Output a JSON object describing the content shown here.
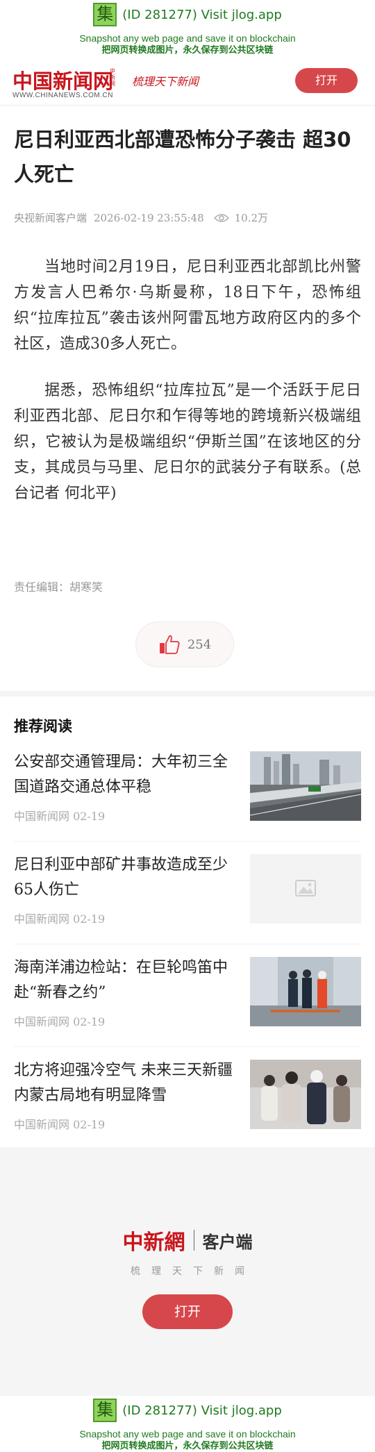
{
  "jlog": {
    "badge": "集",
    "title": "(ID 281277) Visit jlog.app",
    "sub_en": "Snapshot any web page and save it on blockchain",
    "sub_cn": "把网页转换成图片，永久保存到公共区块链"
  },
  "header": {
    "logo_cn": "中国新闻网",
    "logo_tag": "中新网",
    "logo_en": "WWW.CHINANEWS.COM.CN",
    "slogan": "梳理天下新闻",
    "open_label": "打开"
  },
  "article": {
    "headline": "尼日利亚西北部遭恐怖分子袭击 超30人死亡",
    "source": "央视新闻客户端",
    "datetime": "2026-02-19 23:55:48",
    "views": "10.2万",
    "paragraphs": [
      "当地时间2月19日，尼日利亚西北部凯比州警方发言人巴希尔·乌斯曼称，18日下午，恐怖组织“拉库拉瓦”袭击该州阿雷瓦地方政府区内的多个社区，造成30多人死亡。",
      "据悉，恐怖组织“拉库拉瓦”是一个活跃于尼日利亚西北部、尼日尔和乍得等地的跨境新兴极端组织，它被认为是极端组织“伊斯兰国”在该地区的分支，其成员与马里、尼日尔的武装分子有联系。(总台记者 何北平)"
    ],
    "editor": "责任编辑：胡寒笑",
    "likes": "254"
  },
  "recommend": {
    "title": "推荐阅读",
    "items": [
      {
        "title": "公安部交通管理局：大年初三全国道路交通总体平稳",
        "source": "中国新闻网 02-19",
        "thumb": "highway"
      },
      {
        "title": "尼日利亚中部矿井事故造成至少65人伤亡",
        "source": "中国新闻网 02-19",
        "thumb": "placeholder"
      },
      {
        "title": "海南洋浦边检站：在巨轮鸣笛中赴“新春之约”",
        "source": "中国新闻网 02-19",
        "thumb": "officers"
      },
      {
        "title": "北方将迎强冷空气 未来三天新疆内蒙古局地有明显降雪",
        "source": "中国新闻网 02-19",
        "thumb": "crowd"
      }
    ]
  },
  "promo": {
    "logo_cn": "中新網",
    "client": "客户端",
    "slogan": "梳理天下新闻",
    "open_label": "打开"
  },
  "colors": {
    "brand_red": "#c8161d",
    "button_red": "#d6474b",
    "jlog_green": "#1f7a1f"
  }
}
